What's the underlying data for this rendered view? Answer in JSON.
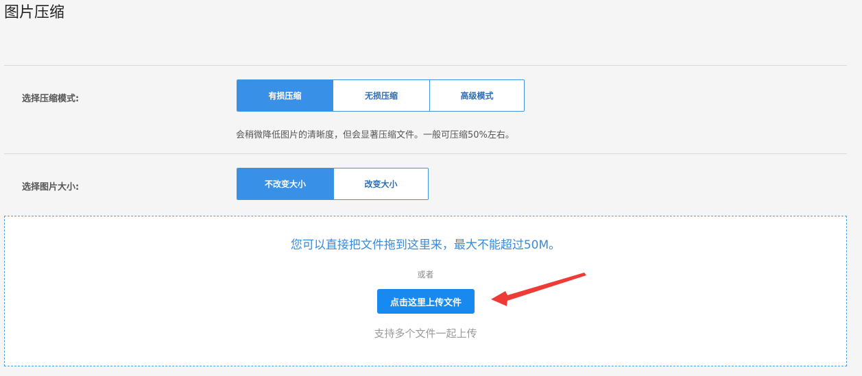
{
  "page": {
    "title": "图片压缩"
  },
  "compression_mode": {
    "label": "选择压缩模式:",
    "options": [
      "有损压缩",
      "无损压缩",
      "高级模式"
    ],
    "selected": "有损压缩",
    "hint": "会稍微降低图片的清晰度，但会显著压缩文件。一般可压缩50%左右。"
  },
  "image_size": {
    "label": "选择图片大小:",
    "options": [
      "不改变大小",
      "改变大小"
    ],
    "selected": "不改变大小"
  },
  "dropzone": {
    "main_text": "您可以直接把文件拖到这里来，最大不能超过50M。",
    "or_text": "或者",
    "upload_button_label": "点击这里上传文件",
    "sub_text": "支持多个文件一起上传"
  },
  "colors": {
    "accent": "#3891e6",
    "upload_button": "#1889ee",
    "annotation_arrow": "#ee3b35"
  }
}
